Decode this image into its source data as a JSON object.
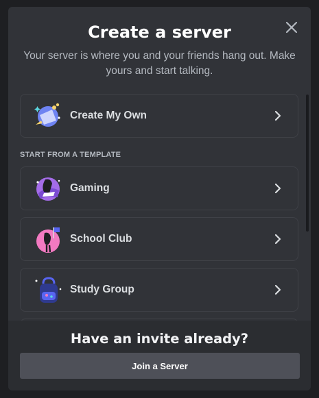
{
  "dialog": {
    "title": "Create a server",
    "subtitle": "Your server is where you and your friends hang out. Make yours and start talking."
  },
  "options": {
    "create_own": {
      "label": "Create My Own",
      "icon": "globe-sparkle-icon"
    },
    "template_heading": "START FROM A TEMPLATE",
    "templates": [
      {
        "label": "Gaming",
        "icon": "gaming-icon"
      },
      {
        "label": "School Club",
        "icon": "school-club-icon"
      },
      {
        "label": "Study Group",
        "icon": "backpack-icon"
      }
    ]
  },
  "footer": {
    "title": "Have an invite already?",
    "join_label": "Join a Server"
  },
  "colors": {
    "background": "#313338",
    "footer_background": "#2b2d31",
    "button": "#4e5058",
    "text_primary": "#ffffff",
    "text_muted": "#b5bac1"
  }
}
